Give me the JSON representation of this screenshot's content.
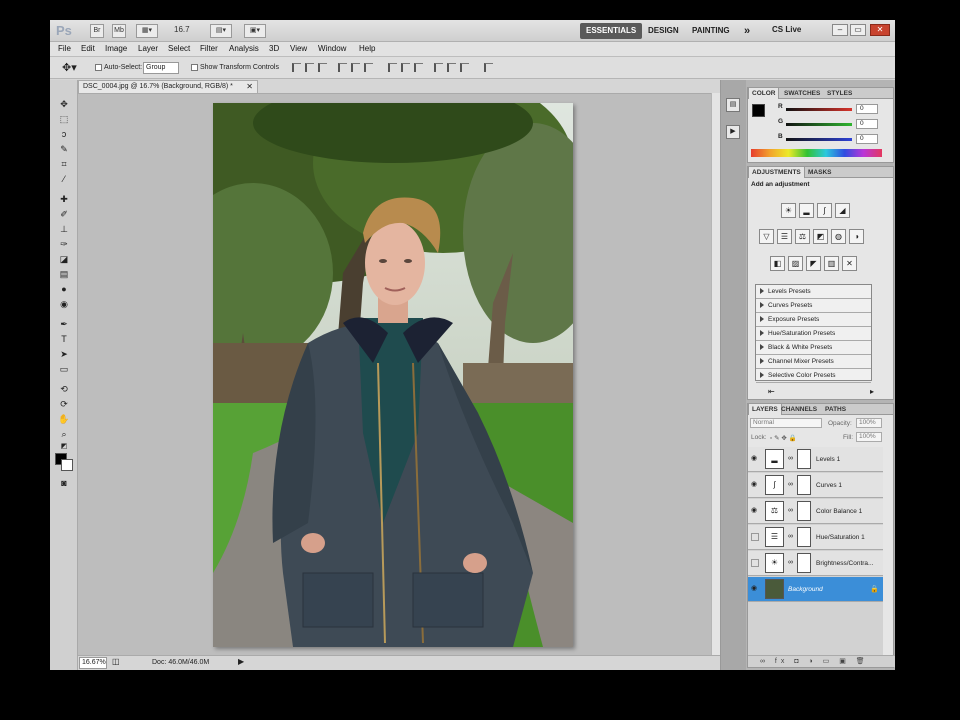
{
  "titlebar": {
    "logo": "Ps",
    "br_label": "Br",
    "mb_label": "Mb",
    "zoom_value": "16.7",
    "workspaces": [
      "ESSENTIALS",
      "DESIGN",
      "PAINTING"
    ],
    "more": "»",
    "cslive": "CS Live",
    "window_buttons": [
      "–",
      "▭",
      "✕"
    ]
  },
  "menu": [
    "File",
    "Edit",
    "Image",
    "Layer",
    "Select",
    "Filter",
    "Analysis",
    "3D",
    "View",
    "Window",
    "Help"
  ],
  "options": {
    "auto_select_label": "Auto-Select:",
    "auto_select_value": "Group",
    "transform_label": "Show Transform Controls"
  },
  "document": {
    "tab_title": "DSC_0004.jpg @ 16.7% (Background, RGB/8) *",
    "tab_close": "✕"
  },
  "status": {
    "zoom": "16.67%",
    "doc": "Doc: 46.0M/46.0M"
  },
  "color_panel": {
    "tabs": [
      "COLOR",
      "SWATCHES",
      "STYLES"
    ],
    "channels": [
      {
        "label": "R",
        "value": "0",
        "color": "#d8342c"
      },
      {
        "label": "G",
        "value": "0",
        "color": "#2fb52f"
      },
      {
        "label": "B",
        "value": "0",
        "color": "#2e42d6"
      }
    ]
  },
  "adjustments_panel": {
    "tabs": [
      "ADJUSTMENTS",
      "MASKS"
    ],
    "heading": "Add an adjustment",
    "presets": [
      "Levels Presets",
      "Curves Presets",
      "Exposure Presets",
      "Hue/Saturation Presets",
      "Black & White Presets",
      "Channel Mixer Presets",
      "Selective Color Presets"
    ]
  },
  "layers_panel": {
    "tabs": [
      "LAYERS",
      "CHANNELS",
      "PATHS"
    ],
    "blend_mode": "Normal",
    "opacity_label": "Opacity:",
    "opacity_value": "100%",
    "lock_label": "Lock:",
    "fill_label": "Fill:",
    "fill_value": "100%",
    "layers": [
      {
        "name": "Levels 1",
        "visible": true,
        "icon": "levels-icon"
      },
      {
        "name": "Curves 1",
        "visible": true,
        "icon": "curves-icon"
      },
      {
        "name": "Color Balance 1",
        "visible": true,
        "icon": "color-balance-icon"
      },
      {
        "name": "Hue/Saturation 1",
        "visible": false,
        "icon": "hue-saturation-icon"
      },
      {
        "name": "Brightness/Contra...",
        "visible": false,
        "icon": "brightness-icon"
      },
      {
        "name": "Background",
        "visible": true,
        "icon": "photo-thumbnail",
        "selected": true
      }
    ]
  },
  "accent_color": "#3b8ed8"
}
